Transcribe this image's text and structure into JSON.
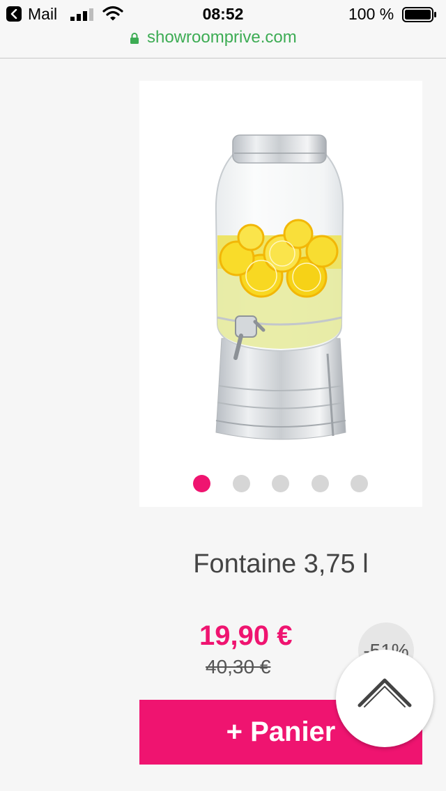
{
  "status_bar": {
    "back_app": "Mail",
    "time": "08:52",
    "battery_percent": "100 %",
    "signal_bars": 3,
    "battery_level": 1.0
  },
  "url_bar": {
    "domain": "showroomprive.com",
    "lock_color": "#3dac54"
  },
  "product": {
    "title": "Fontaine 3,75 l",
    "price": "19,90 €",
    "old_price": "40,30 €",
    "discount": "-51%",
    "image_count": 5,
    "active_image": 1
  },
  "actions": {
    "add_to_cart": "+ Panier",
    "scroll_top_icon": "chevron-up-icon"
  },
  "colors": {
    "accent": "#ef1470",
    "secure": "#3dac54"
  }
}
